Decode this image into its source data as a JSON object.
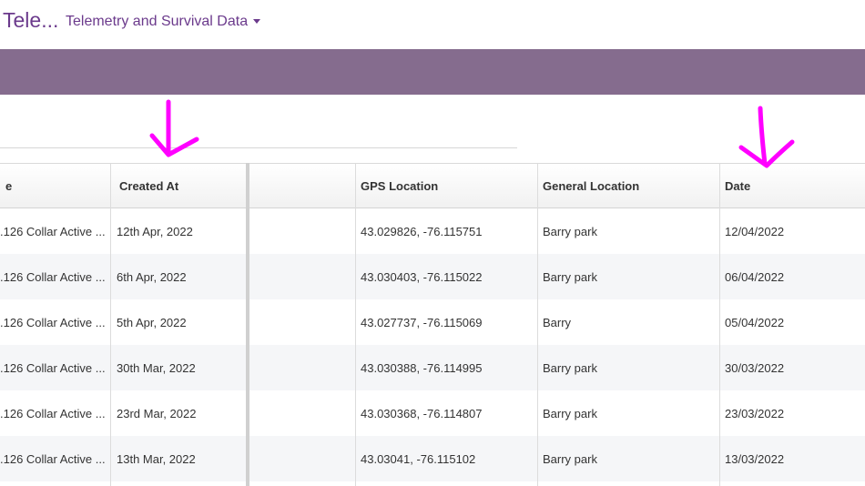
{
  "header": {
    "app_title": "Tele...",
    "data_menu_label": "Telemetry and Survival Data"
  },
  "colors": {
    "brand_purple": "#6b3a8c",
    "band": "#856c8e",
    "annotation_magenta": "#ff00ff"
  },
  "icons": [
    "caret-down-icon",
    "annotation-arrow-icon"
  ],
  "table": {
    "columns": {
      "status": "e",
      "created_at": "Created At",
      "gps": "GPS Location",
      "general": "General Location",
      "date": "Date"
    },
    "rows": [
      {
        "status": ".126 Collar Active ...",
        "created_at": "12th Apr, 2022",
        "gps": "43.029826, -76.115751",
        "general": "Barry park",
        "date": "12/04/2022"
      },
      {
        "status": ".126 Collar Active ...",
        "created_at": "6th Apr, 2022",
        "gps": "43.030403, -76.115022",
        "general": "Barry park",
        "date": "06/04/2022"
      },
      {
        "status": ".126 Collar Active ...",
        "created_at": "5th Apr, 2022",
        "gps": "43.027737, -76.115069",
        "general": "Barry",
        "date": "05/04/2022"
      },
      {
        "status": ".126 Collar Active ...",
        "created_at": "30th Mar, 2022",
        "gps": "43.030388, -76.114995",
        "general": "Barry park",
        "date": "30/03/2022"
      },
      {
        "status": ".126 Collar Active ...",
        "created_at": "23rd Mar, 2022",
        "gps": "43.030368, -76.114807",
        "general": "Barry park",
        "date": "23/03/2022"
      },
      {
        "status": ".126 Collar Active ...",
        "created_at": "13th Mar, 2022",
        "gps": "43.03041, -76.115102",
        "general": "Barry park",
        "date": "13/03/2022"
      }
    ]
  }
}
